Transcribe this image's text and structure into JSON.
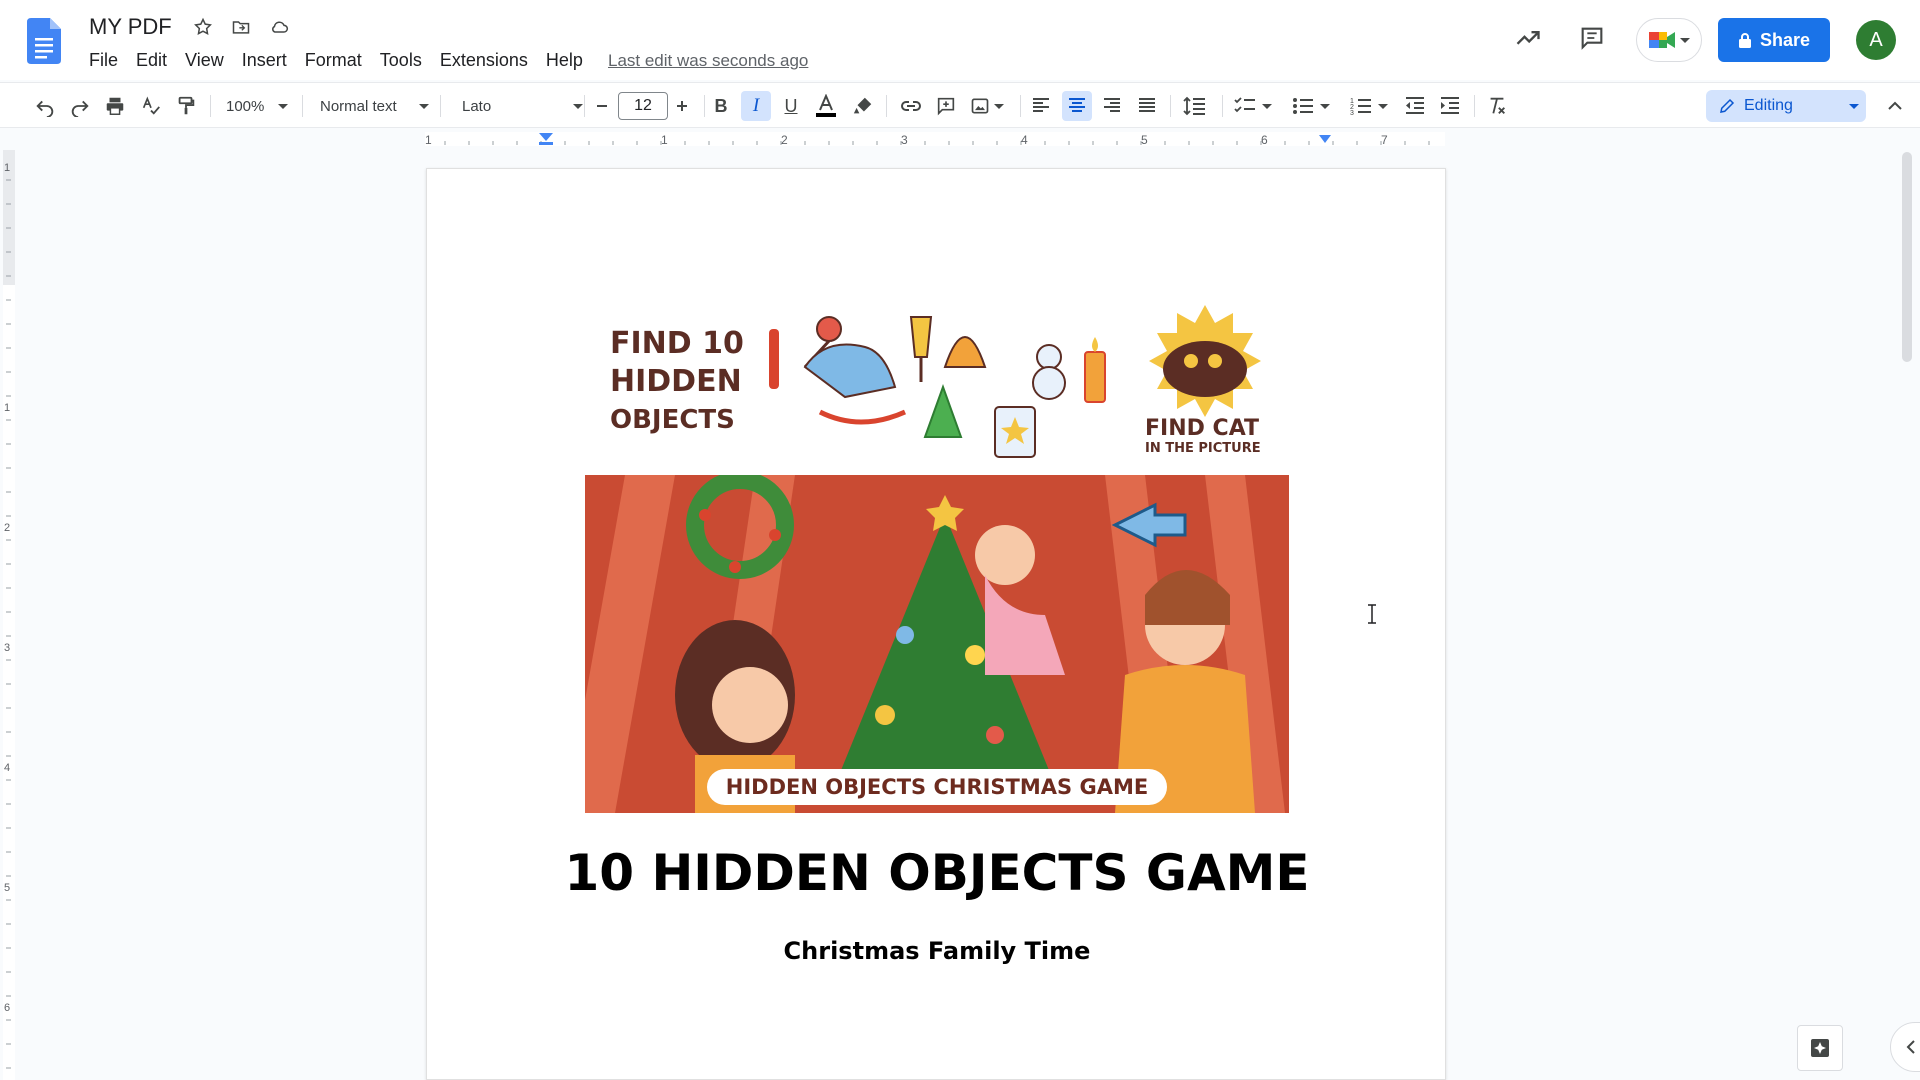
{
  "header": {
    "title": "MY PDF",
    "menu": [
      "File",
      "Edit",
      "View",
      "Insert",
      "Format",
      "Tools",
      "Extensions",
      "Help"
    ],
    "last_edit": "Last edit was seconds ago",
    "share_label": "Share",
    "avatar_letter": "A"
  },
  "toolbar": {
    "zoom": "100%",
    "style": "Normal text",
    "font": "Lato",
    "font_size": "12",
    "mode": "Editing"
  },
  "ruler": {
    "numbers": [
      "1",
      "1",
      "2",
      "3",
      "4",
      "5",
      "6",
      "7"
    ],
    "vertical_numbers": [
      "1",
      "1",
      "2",
      "3",
      "4",
      "5",
      "6"
    ]
  },
  "document": {
    "banner_find_text": [
      "FIND 10",
      "HIDDEN",
      "OBJECTS"
    ],
    "banner_find_cat": "FIND CAT",
    "banner_find_cat_sub": "IN THE PICTURE",
    "banner_label": "HIDDEN OBJECTS CHRISTMAS GAME",
    "heading": "10 HIDDEN OBJECTS GAME",
    "subheading": "Christmas Family Time"
  },
  "colors": {
    "share_blue": "#1a73e8",
    "editing_bg": "#d3e3fd",
    "avatar_green": "#2e7d32",
    "scene_red": "#d0543a"
  }
}
